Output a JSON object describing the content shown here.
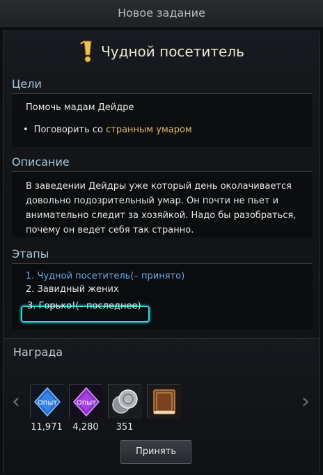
{
  "window": {
    "title": "Новое задание"
  },
  "quest": {
    "name": "Чудной посетитель"
  },
  "goals": {
    "heading": "Цели",
    "main": "Помочь мадам Дейдре",
    "sub_prefix": "Поговорить со ",
    "sub_highlight": "странным умаром",
    "bullet": "•"
  },
  "description": {
    "heading": "Описание",
    "text": "В заведении Дейдры уже который день околачивается довольно подозрительный умар. Он почти не пьет и внимательно следит за хозяйкой. Надо бы разобраться, почему он ведет себя так странно."
  },
  "stages": {
    "heading": "Этапы",
    "items": [
      {
        "label": "1. Чудной посетитель(– принято)"
      },
      {
        "label": "2. Завидный жених"
      },
      {
        "label": "3. Горько!(– последнее)"
      }
    ]
  },
  "reward": {
    "heading": "Награда",
    "items": [
      {
        "icon": "exp-crystal-blue-icon",
        "badge": "Опыт",
        "count": "11,971"
      },
      {
        "icon": "exp-crystal-purple-icon",
        "badge": "Опыт",
        "count": "4,280"
      },
      {
        "icon": "silver-coins-icon",
        "count": "351"
      },
      {
        "icon": "book-icon",
        "count": ""
      }
    ],
    "accept_label": "Принять"
  },
  "nav": {
    "left": "‹",
    "right": "›"
  },
  "colors": {
    "highlight": "#e0b66b",
    "active_stage": "#6aa6e8",
    "frame": "#33d3e0"
  }
}
